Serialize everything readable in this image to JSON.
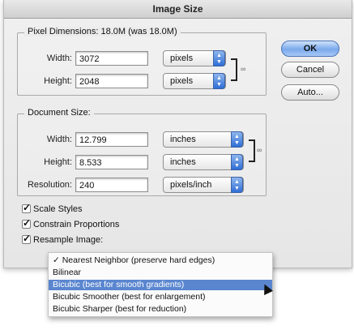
{
  "dialog": {
    "title": "Image Size"
  },
  "pixel_dimensions": {
    "title": "Pixel Dimensions:  18.0M (was 18.0M)",
    "width_label": "Width:",
    "width_value": "3072",
    "width_unit": "pixels",
    "height_label": "Height:",
    "height_value": "2048",
    "height_unit": "pixels"
  },
  "document_size": {
    "title": "Document Size:",
    "width_label": "Width:",
    "width_value": "12.799",
    "width_unit": "inches",
    "height_label": "Height:",
    "height_value": "8.533",
    "height_unit": "inches",
    "resolution_label": "Resolution:",
    "resolution_value": "240",
    "resolution_unit": "pixels/inch"
  },
  "buttons": {
    "ok": "OK",
    "cancel": "Cancel",
    "auto": "Auto..."
  },
  "options": [
    {
      "label": "Scale Styles",
      "checked": true
    },
    {
      "label": "Constrain Proportions",
      "checked": true
    },
    {
      "label": "Resample Image:",
      "checked": true
    }
  ],
  "resample_menu": {
    "items": [
      {
        "label": "✓ Nearest Neighbor (preserve hard edges)",
        "selected": false
      },
      {
        "label": "Bilinear",
        "selected": false
      },
      {
        "label": "Bicubic (best for smooth gradients)",
        "selected": true
      },
      {
        "label": "Bicubic Smoother (best for enlargement)",
        "selected": false
      },
      {
        "label": "Bicubic Sharper (best for reduction)",
        "selected": false
      }
    ]
  },
  "icons": {
    "chain": "link-icon",
    "stepper": "updown-arrows-icon",
    "check": "checkmark-icon"
  },
  "colors": {
    "accent": "#5a86cf",
    "ok_button": "#7aa9ec"
  }
}
